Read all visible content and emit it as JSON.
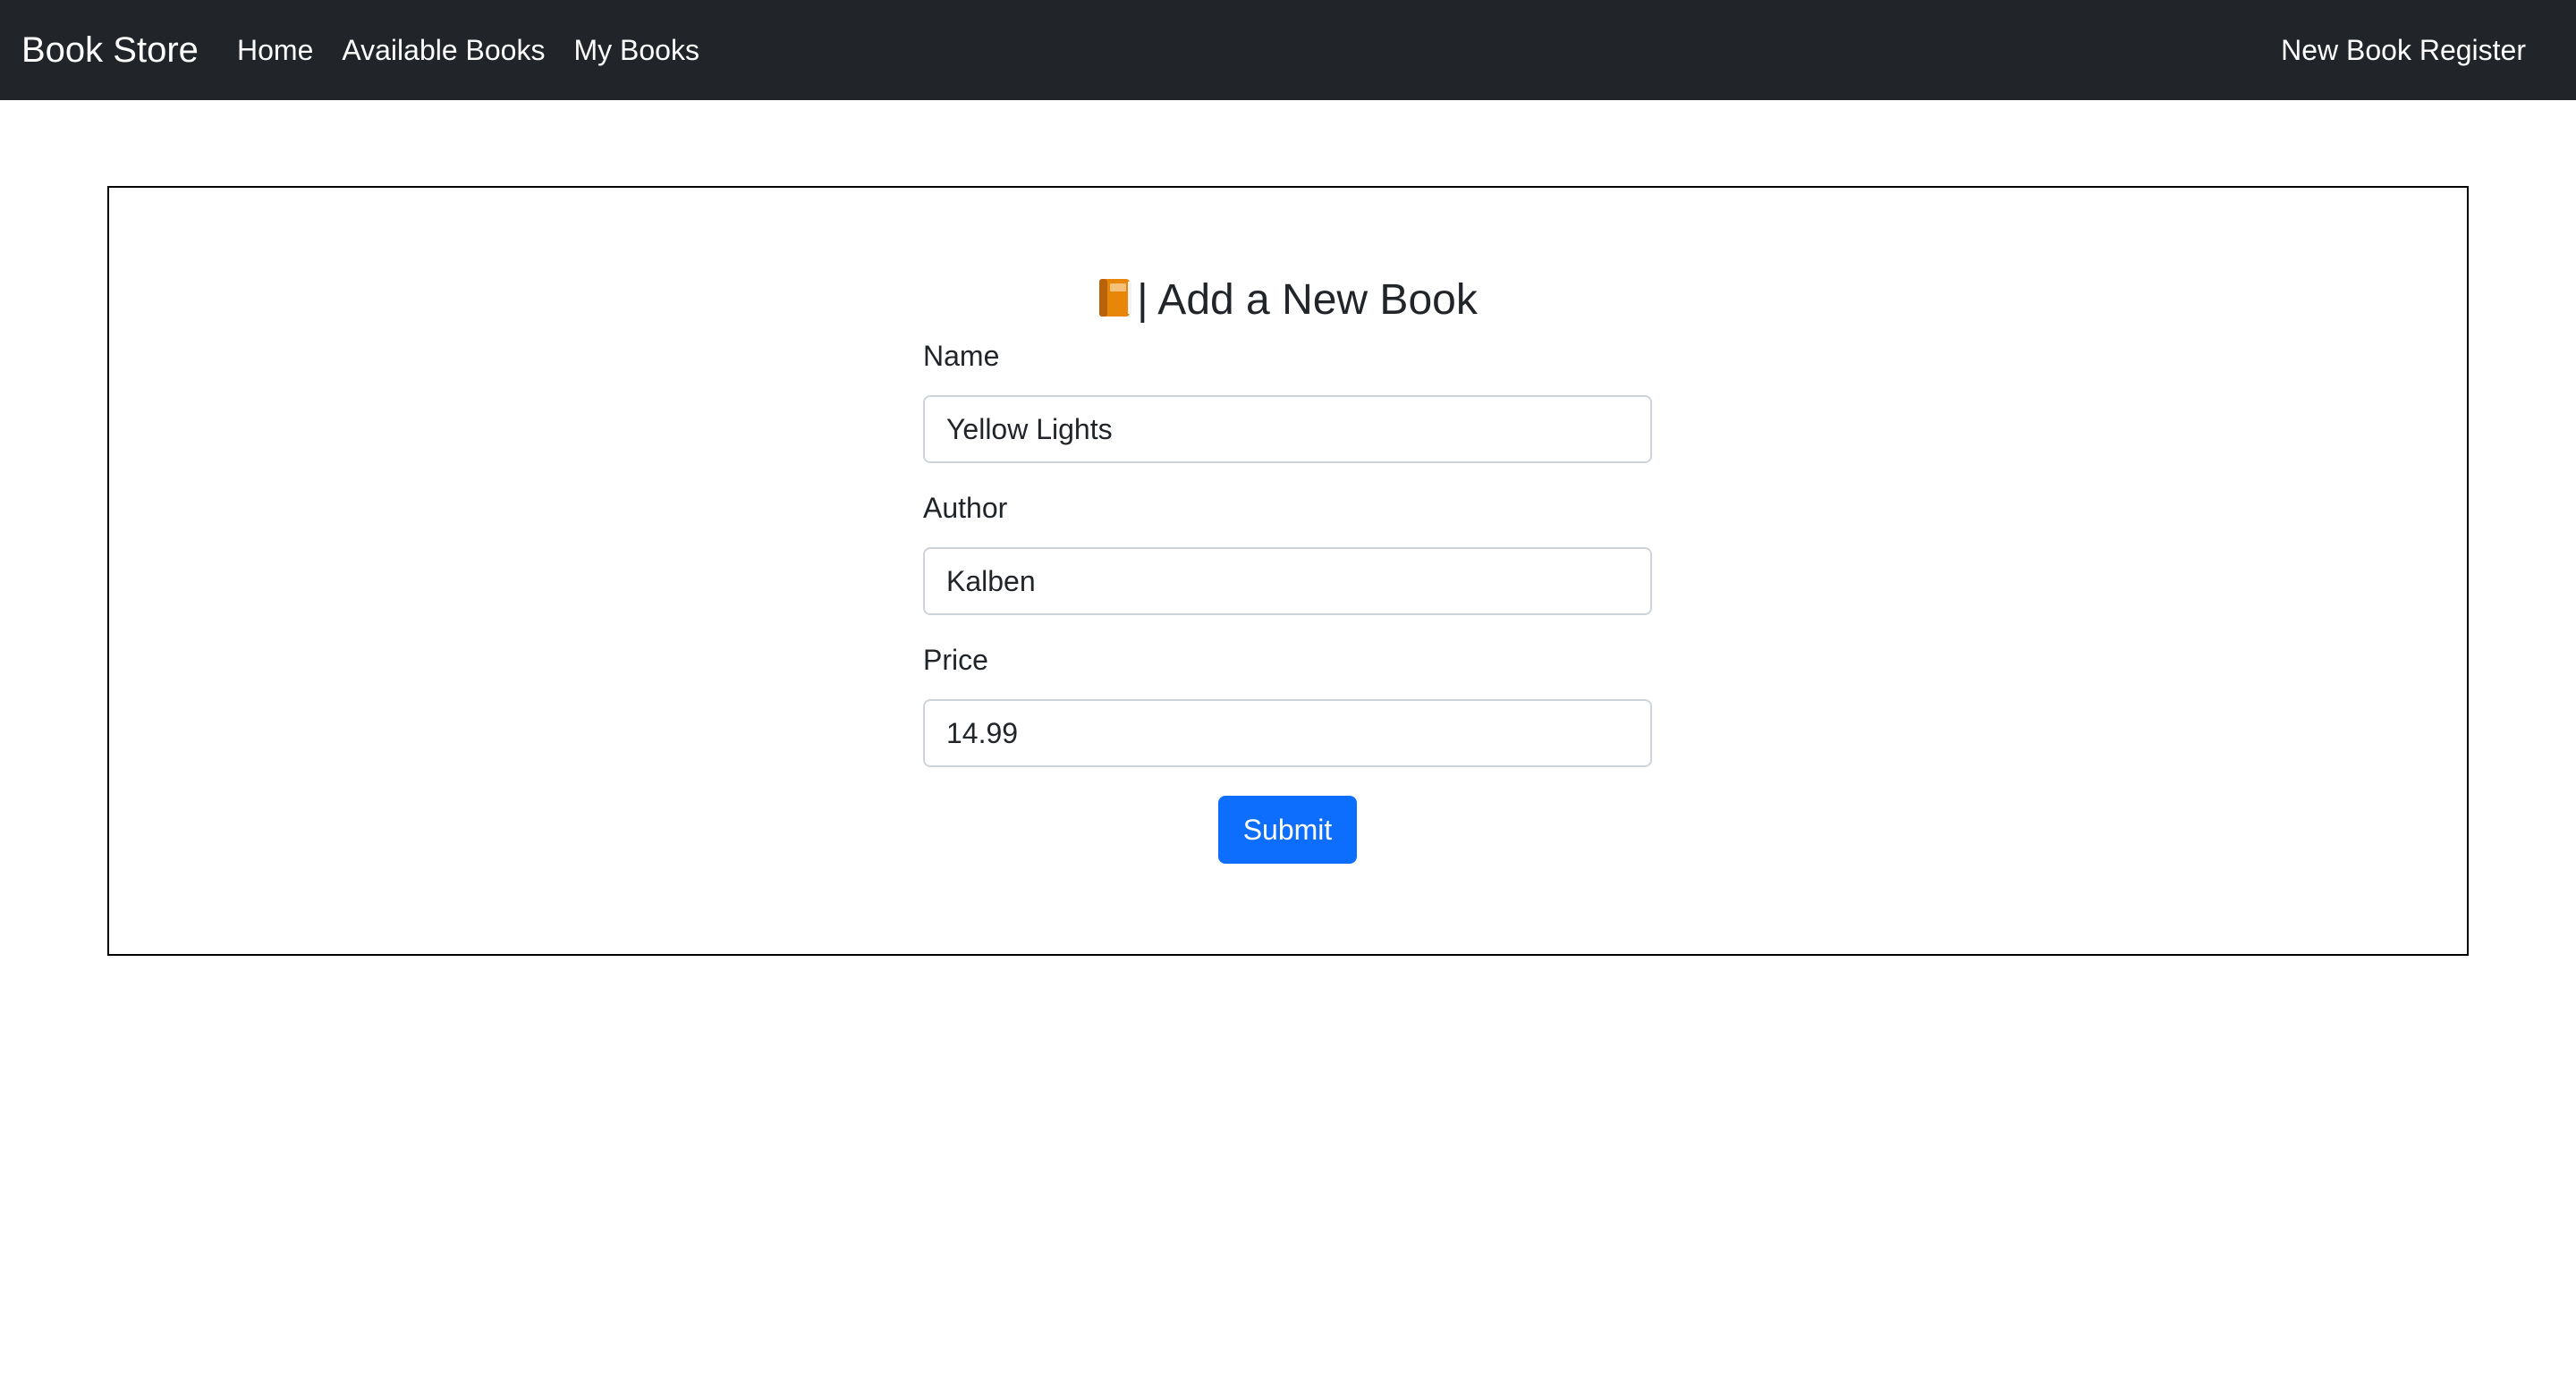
{
  "navbar": {
    "brand": "Book Store",
    "links": [
      {
        "label": "Home"
      },
      {
        "label": "Available Books"
      },
      {
        "label": "My Books"
      }
    ],
    "right_link": "New Book Register",
    "background": "#212529"
  },
  "form": {
    "icon": "orange-book-icon",
    "title": "| Add a New Book",
    "fields": {
      "name": {
        "label": "Name",
        "value": "Yellow Lights"
      },
      "author": {
        "label": "Author",
        "value": "Kalben"
      },
      "price": {
        "label": "Price",
        "value": "14.99"
      }
    },
    "submit_label": "Submit",
    "submit_color": "#0d6efd"
  }
}
